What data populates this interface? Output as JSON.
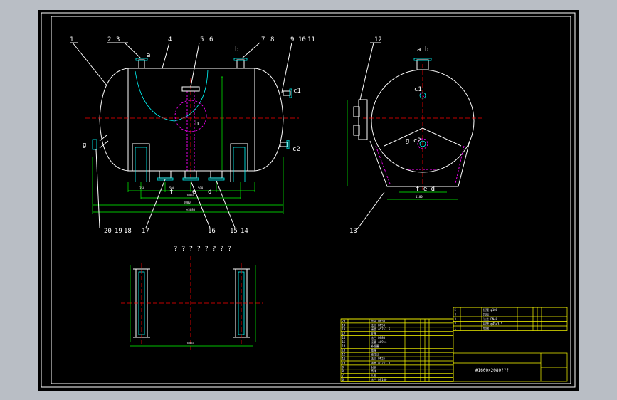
{
  "callouts_front": [
    "1",
    "2",
    "3",
    "4",
    "5",
    "6",
    "7",
    "8",
    "9",
    "10",
    "11",
    "g"
  ],
  "callouts_front_bottom": [
    "20",
    "19",
    "18",
    "17",
    "16",
    "15",
    "14"
  ],
  "callouts_side": [
    "12",
    "13"
  ],
  "nozzle_letters": {
    "a": "a",
    "b": "b",
    "c": "c",
    "d": "d",
    "e": "e",
    "f": "f",
    "h": "h",
    "c1": "c1",
    "c2": "c2",
    "ab": "a b",
    "c1s": "c1",
    "gc2": "g c2",
    "fed": "f e d"
  },
  "plan_title": "? ? ? ? ? ? ? ?",
  "drawing_title": "#1600×2080???",
  "parts_rows": [
    {
      "no": "20",
      "name": "弯头 DN50"
    },
    {
      "no": "19",
      "name": "法兰 DN50"
    },
    {
      "no": "18",
      "name": "接管 φ57×3.5"
    },
    {
      "no": "17",
      "name": "支座"
    },
    {
      "no": "16",
      "name": "法兰 DN80"
    },
    {
      "no": "15",
      "name": "接管 φ89×4"
    },
    {
      "no": "14",
      "name": "补强圈"
    },
    {
      "no": "13",
      "name": "鞍座"
    },
    {
      "no": "12",
      "name": "液位计"
    },
    {
      "no": "11",
      "name": "法兰 DN25"
    },
    {
      "no": "10",
      "name": "接管 φ32×3.5"
    },
    {
      "no": "9",
      "name": "封头"
    },
    {
      "no": "8",
      "name": "筒体"
    },
    {
      "no": "7",
      "name": "人孔"
    },
    {
      "no": "6",
      "name": "法兰 DN100"
    }
  ],
  "parts_rows_upper": [
    {
      "no": "5",
      "name": "接管 φ108"
    },
    {
      "no": "4",
      "name": "挡板"
    },
    {
      "no": "3",
      "name": "法兰 DN40"
    },
    {
      "no": "2",
      "name": "接管 φ45×3.5"
    },
    {
      "no": "1",
      "name": "铭牌"
    }
  ],
  "colors": {
    "background": "#000000",
    "outline": "#ffffff",
    "dimension": "#00ff00",
    "centerline": "#ff0000",
    "hidden": "#ff00ff",
    "nozzle": "#00ffff",
    "text_table": "#ffff00"
  }
}
